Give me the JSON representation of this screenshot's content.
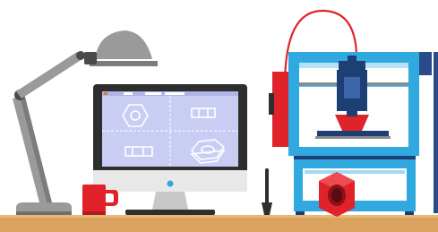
{
  "colors": {
    "desk": "#d9a25e",
    "desk_shadow": "#b9834a",
    "printer_frame": "#30a8e0",
    "printer_inner": "#ffffff",
    "printer_dark": "#1e3f73",
    "printer_red": "#e0232a",
    "screen_bg": "#c9cdf4",
    "monitor_dark": "#2e2e2e",
    "lamp_gray": "#9a9a9a",
    "lamp_dark": "#4a4a4a",
    "mug_red": "#e0232a",
    "accent_blue": "#2a4a8a"
  },
  "icons": {
    "lamp": "desk-lamp-icon",
    "monitor": "monitor-icon",
    "cad_bolt_top": "hex-nut-front-icon",
    "cad_side_top": "nut-side-icon",
    "cad_side_bottom": "nut-side-icon",
    "cad_iso": "hex-nut-3d-icon",
    "mug": "mug-icon",
    "stylus": "pen-icon",
    "printer": "3d-printer-icon",
    "printed_nut": "hex-nut-icon"
  }
}
